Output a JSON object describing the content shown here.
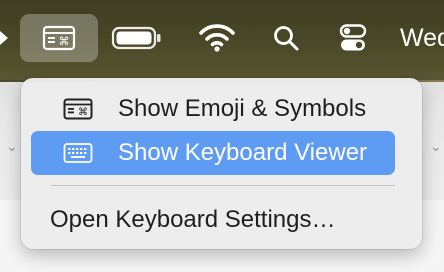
{
  "menubar": {
    "icons": [
      "emoji-symbols-icon",
      "battery-icon",
      "wifi-icon",
      "search-icon",
      "control-center-icon"
    ],
    "clock_partial": "Wed"
  },
  "input_menu": {
    "items": [
      {
        "label": "Show Emoji & Symbols",
        "icon": "emoji-symbols-icon",
        "selected": false
      },
      {
        "label": "Show Keyboard Viewer",
        "icon": "keyboard-icon",
        "selected": true
      },
      {
        "label": "Open Keyboard Settings…",
        "icon": null,
        "selected": false
      }
    ]
  },
  "colors": {
    "menubar_bg": "#4a4826",
    "selection": "#5e9bf2",
    "menu_bg": "#ececec"
  }
}
